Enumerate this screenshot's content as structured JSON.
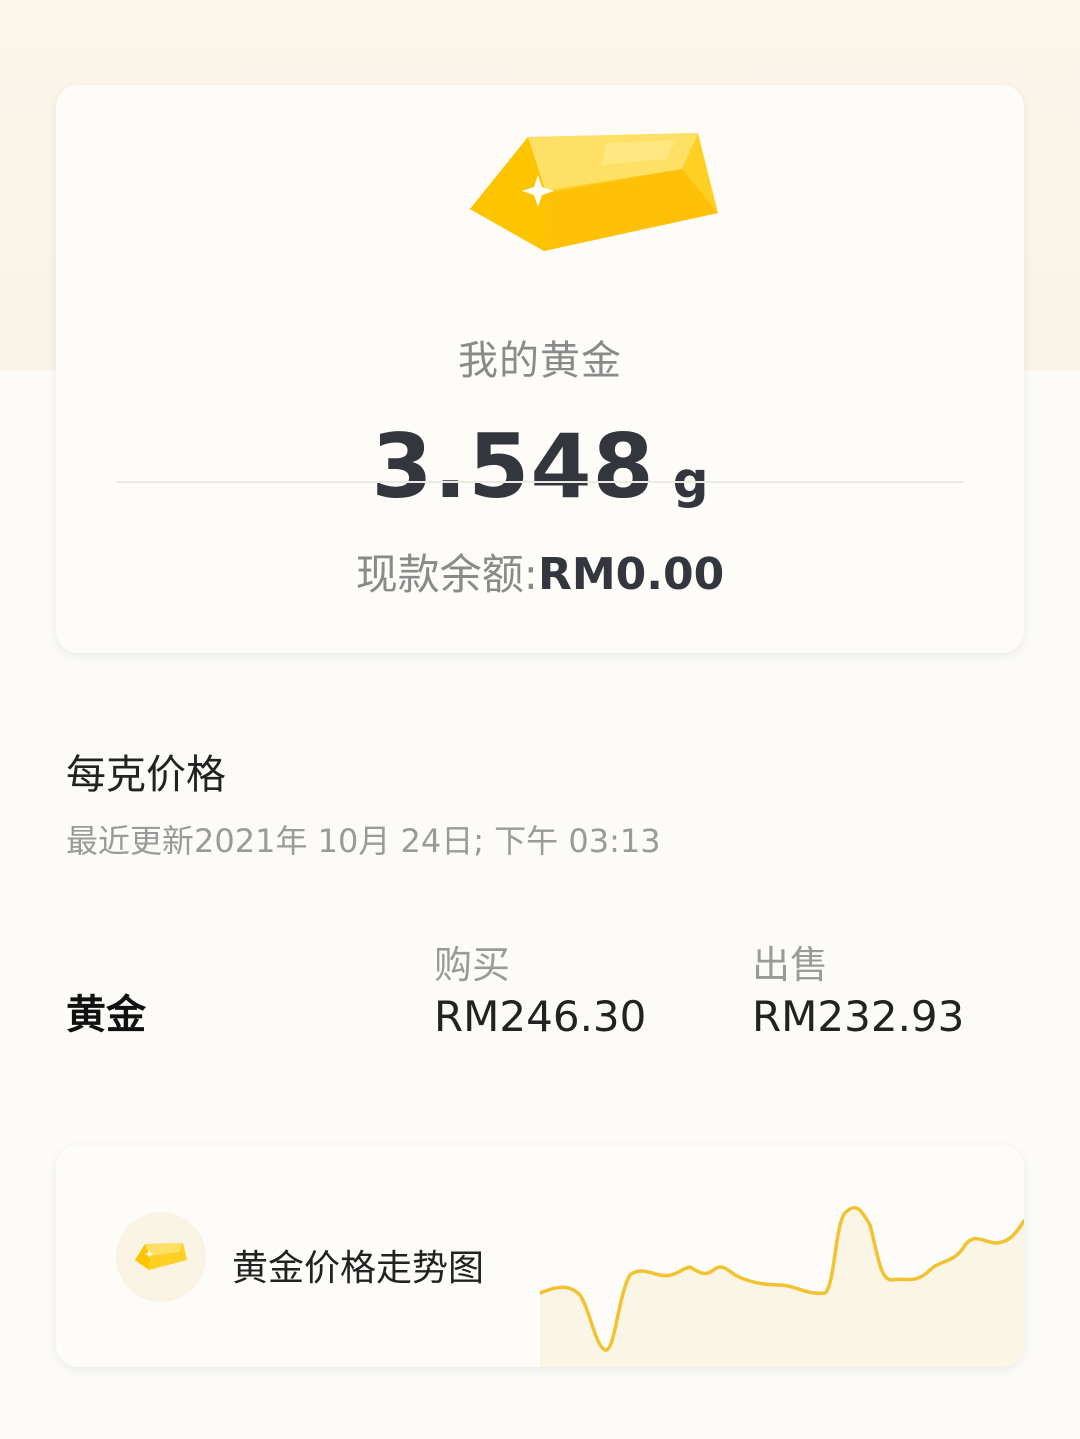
{
  "holdings": {
    "title": "我的黄金",
    "weight_value": "3.548",
    "weight_unit": "g",
    "balance_label": "现款余额:",
    "balance_value": "RM0.00",
    "icon": "gold-bar-icon"
  },
  "price_section": {
    "heading": "每克价格",
    "updated": "最近更新2021年 10月 24日; 下午 03:13",
    "metal": "黄金",
    "buy_label": "购买",
    "buy_price": "RM246.30",
    "sell_label": "出售",
    "sell_price": "RM232.93"
  },
  "trend": {
    "label": "黄金价格走势图",
    "icon": "gold-bar-icon",
    "line_color": "#f2c230",
    "fill_color": "#fbf5e6"
  },
  "colors": {
    "gold": "#ffcc1a",
    "text_dark": "#33373d",
    "text_muted": "#8a8a8a"
  }
}
